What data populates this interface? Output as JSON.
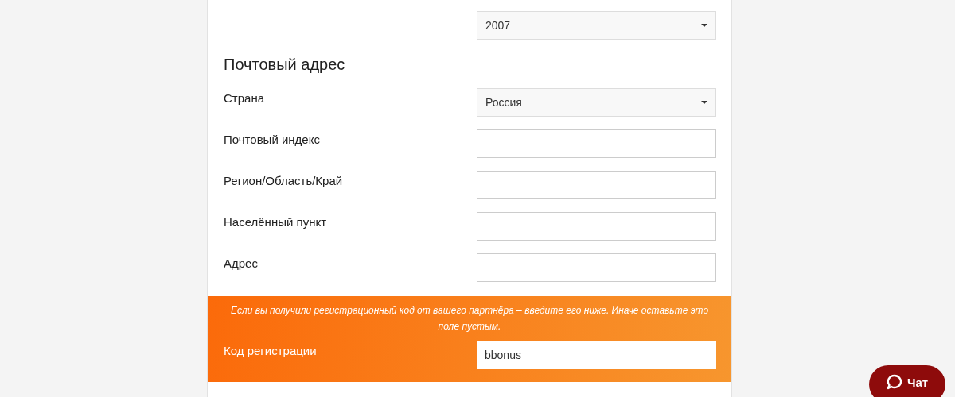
{
  "year_select": {
    "value": "2007"
  },
  "section_title": "Почтовый адрес",
  "fields": [
    {
      "kind": "select",
      "label": "Страна",
      "value": "Россия"
    },
    {
      "kind": "text",
      "label": "Почтовый индекс"
    },
    {
      "kind": "text",
      "label": "Регион/Область/Край"
    },
    {
      "kind": "text",
      "label": "Населённый пункт"
    },
    {
      "kind": "text",
      "label": "Адрес"
    }
  ],
  "promo": {
    "note": "Если вы получили регистрационный код от вашего партнёра – введите его ниже. Иначе оставьте это поле пустым.",
    "label": "Код регистрации",
    "value": "bbonus"
  },
  "chat_button": {
    "label": "Чат"
  }
}
